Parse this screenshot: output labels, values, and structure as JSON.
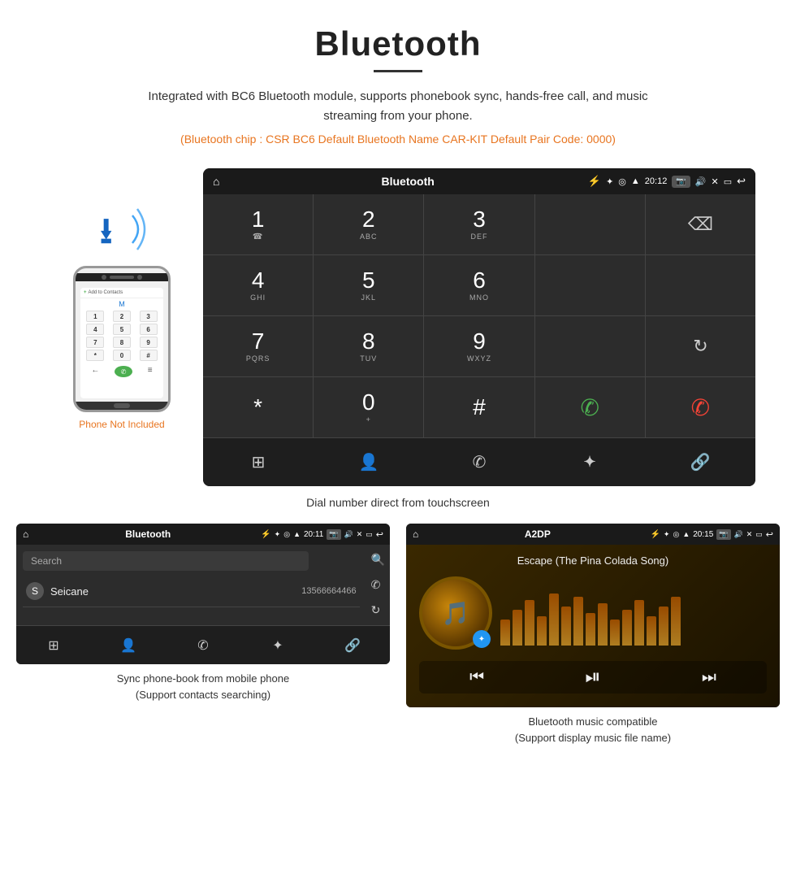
{
  "page": {
    "title": "Bluetooth",
    "description": "Integrated with BC6 Bluetooth module, supports phonebook sync, hands-free call, and music streaming from your phone.",
    "bluetooth_info": "(Bluetooth chip : CSR BC6    Default Bluetooth Name CAR-KIT    Default Pair Code: 0000)"
  },
  "phone_area": {
    "not_included": "Phone Not Included"
  },
  "hmi_big": {
    "status_bar": {
      "page_name": "Bluetooth",
      "time": "20:12"
    },
    "dialpad": {
      "keys": [
        {
          "num": "1",
          "sub": ""
        },
        {
          "num": "2",
          "sub": "ABC"
        },
        {
          "num": "3",
          "sub": "DEF"
        },
        {
          "num": "4",
          "sub": "GHI"
        },
        {
          "num": "5",
          "sub": "JKL"
        },
        {
          "num": "6",
          "sub": "MNO"
        },
        {
          "num": "7",
          "sub": "PQRS"
        },
        {
          "num": "8",
          "sub": "TUV"
        },
        {
          "num": "9",
          "sub": "WXYZ"
        },
        {
          "num": "*",
          "sub": ""
        },
        {
          "num": "0",
          "sub": "+"
        },
        {
          "num": "#",
          "sub": ""
        }
      ]
    },
    "caption": "Dial number direct from touchscreen"
  },
  "hmi_phonebook": {
    "status_bar": {
      "page_name": "Bluetooth",
      "time": "20:11"
    },
    "search_placeholder": "Search",
    "contacts": [
      {
        "letter": "S",
        "name": "Seicane",
        "phone": "13566664466"
      }
    ],
    "caption": "Sync phone-book from mobile phone\n(Support contacts searching)"
  },
  "hmi_music": {
    "status_bar": {
      "page_name": "A2DP",
      "time": "20:15"
    },
    "song_title": "Escape (The Pina Colada Song)",
    "eq_bars": [
      40,
      55,
      70,
      45,
      80,
      60,
      75,
      50,
      65,
      40,
      55,
      70,
      45,
      60,
      75
    ],
    "caption": "Bluetooth music compatible\n(Support display music file name)"
  },
  "icons": {
    "home": "⌂",
    "bluetooth": "✦",
    "usb": "⚡",
    "bt_sym": "❋",
    "back": "↩",
    "camera": "📷",
    "volume": "🔊",
    "close_x": "✕",
    "window": "▭",
    "location": "◎",
    "signal": "▲",
    "search": "🔍",
    "phone_call": "✆",
    "reload": "↻",
    "backspace": "⌫",
    "grid": "⊞",
    "person": "👤",
    "link": "🔗",
    "prev": "⏮",
    "play_pause": "⏯",
    "next": "⏭"
  }
}
